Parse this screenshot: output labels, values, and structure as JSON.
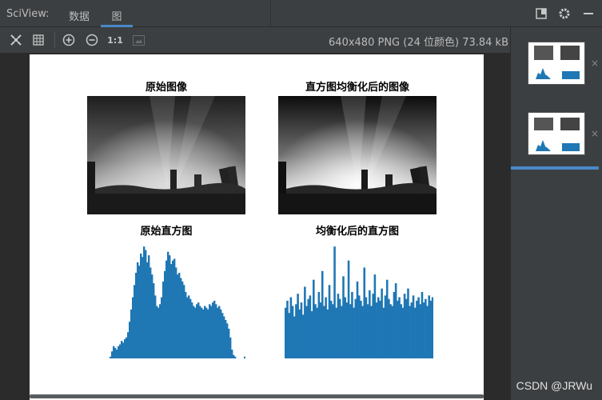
{
  "topbar": {
    "app_title": "SciView:",
    "tabs": [
      {
        "label": "数据"
      },
      {
        "label": "图"
      }
    ],
    "icons": [
      "layout-icon",
      "gear-icon",
      "minimize-icon"
    ]
  },
  "toolbar": {
    "icons": [
      "fit-window-icon",
      "grid-icon",
      "zoom-in-icon",
      "zoom-out-icon",
      "actual-size-icon",
      "background-icon"
    ],
    "actual_size_label": "1:1",
    "image_info": "640x480 PNG (24 位颜色) 73.84 kB"
  },
  "figure": {
    "titles": {
      "original_image": "原始图像",
      "equalized_image": "直方图均衡化后的图像",
      "original_hist": "原始直方图",
      "equalized_hist": "均衡化后的直方图"
    },
    "colors": {
      "bar": "#1f77b4",
      "background": "#ffffff"
    }
  },
  "chart_data": [
    {
      "type": "bar",
      "title": "原始直方图",
      "x_range": [
        0,
        255
      ],
      "values_description": "histogram peaking near intensity 45–75",
      "values": [
        0,
        0,
        0,
        0,
        0,
        0,
        0,
        0,
        0,
        0,
        2,
        8,
        14,
        12,
        10,
        14,
        16,
        20,
        18,
        22,
        24,
        30,
        42,
        56,
        70,
        84,
        98,
        110,
        106,
        120,
        116,
        128,
        124,
        110,
        118,
        104,
        96,
        86,
        72,
        60,
        58,
        62,
        70,
        88,
        100,
        112,
        122,
        118,
        108,
        112,
        114,
        104,
        96,
        98,
        92,
        88,
        84,
        76,
        70,
        72,
        68,
        64,
        60,
        58,
        62,
        64,
        60,
        58,
        56,
        60,
        58,
        56,
        62,
        60,
        64,
        66,
        62,
        58,
        60,
        56,
        52,
        48,
        44,
        40,
        34,
        24,
        10,
        4,
        2,
        0,
        0,
        0,
        0,
        0,
        2
      ]
    },
    {
      "type": "bar",
      "title": "均衡化后的直方图",
      "x_range": [
        0,
        255
      ],
      "values": [
        58,
        66,
        52,
        70,
        60,
        48,
        62,
        74,
        56,
        64,
        50,
        82,
        60,
        68,
        72,
        54,
        90,
        62,
        58,
        76,
        64,
        100,
        60,
        70,
        56,
        84,
        66,
        62,
        128,
        58,
        74,
        68,
        60,
        94,
        70,
        64,
        112,
        62,
        76,
        58,
        68,
        88,
        72,
        66,
        60,
        104,
        70,
        62,
        78,
        60,
        74,
        96,
        64,
        70,
        66,
        80,
        58,
        72,
        90,
        68,
        62,
        60,
        76,
        86,
        66,
        70,
        62,
        58,
        74,
        68,
        80,
        60,
        64,
        72,
        58,
        66,
        70,
        62,
        76,
        64,
        68,
        60,
        72,
        66,
        70
      ]
    }
  ],
  "side_panel": {
    "thumbnails": 2,
    "close_icon": "×"
  },
  "watermark": "CSDN @JRWu"
}
